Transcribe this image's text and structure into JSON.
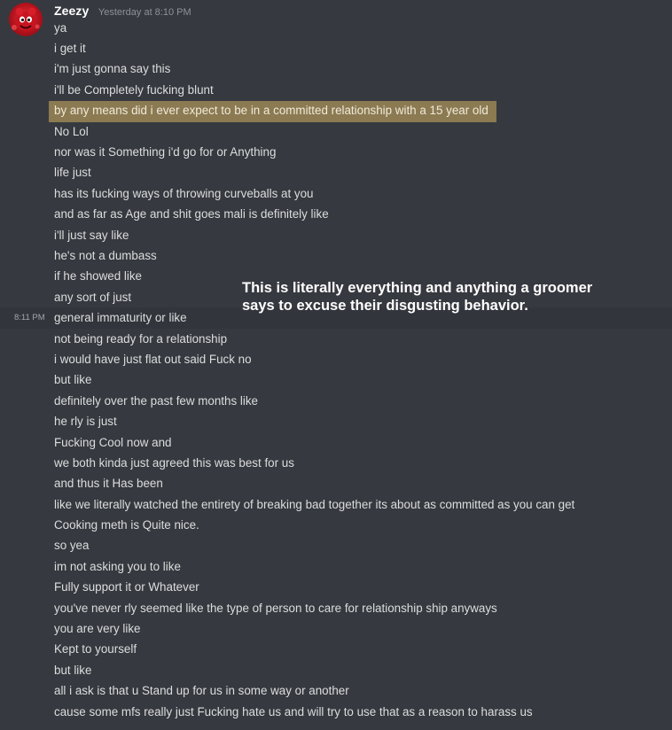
{
  "message": {
    "username": "Zeezy",
    "timestamp": "Yesterday at 8:10 PM",
    "hover_time": "8:11 PM",
    "lines": [
      "ya",
      "i get it",
      "i'm just gonna say this",
      "i'll be Completely fucking blunt",
      "by any means did i ever expect to be in a committed relationship with a 15 year old",
      "No Lol",
      "nor was it Something i'd go for or Anything",
      "life just",
      "has its fucking ways of throwing curveballs at you",
      "and as far as Age and shit goes mali is definitely like",
      "i'll just say like",
      "he's not a dumbass",
      "if he showed like",
      "any sort of just",
      "general immaturity or like",
      "not being ready for a relationship",
      "i would have just flat out said Fuck no",
      "but like",
      "definitely over the past few months like",
      "he rly is just",
      "Fucking Cool now and",
      "we both kinda just agreed this was best for us",
      "and thus it Has been",
      "like we literally watched the entirety of breaking bad together its about as committed as you can get",
      "Cooking meth is Quite nice.",
      "so yea",
      "im not asking you to like",
      "Fully support it or Whatever",
      "you've never rly seemed like the type of person to care for relationship ship anyways",
      "you are very like",
      "Kept to yourself",
      "but like",
      "all i ask is that u Stand up for us in some way or another",
      "cause some mfs really just Fucking hate us and will try to use that as a reason to harass us"
    ]
  },
  "annotation": {
    "line1": "This is literally everything and anything a groomer",
    "line2": "says to excuse their disgusting behavior."
  },
  "colors": {
    "background": "#36393f",
    "hover_row": "#32353b",
    "highlight": "#8b7a52",
    "text": "#dcddde",
    "username": "#ffffff",
    "timestamp": "#8e9297"
  },
  "icons": {
    "avatar": "red-cartoon-avatar"
  }
}
